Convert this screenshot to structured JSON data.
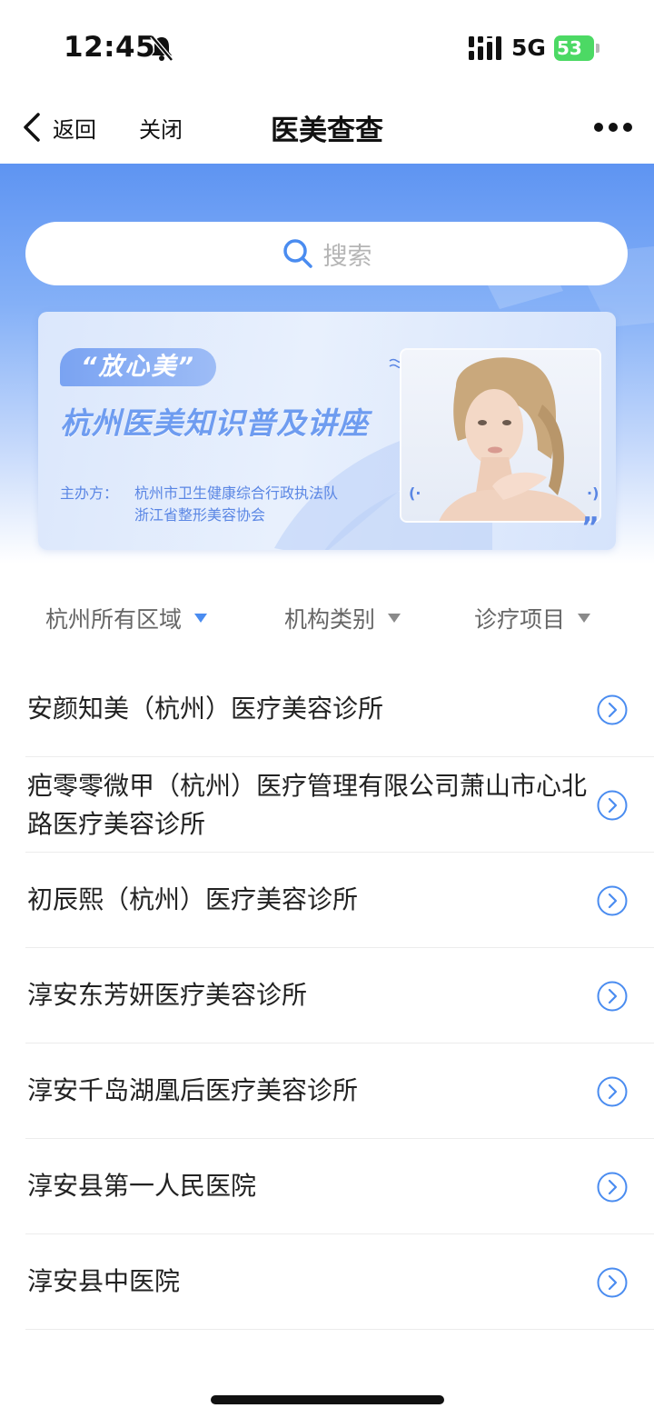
{
  "status_bar": {
    "time": "12:45",
    "network": "5G",
    "battery": "53",
    "icons": [
      "bell-slash-icon",
      "signal-icon",
      "battery-charging-icon"
    ]
  },
  "nav": {
    "back_label": "返回",
    "close_label": "关闭",
    "title": "医美查查",
    "icons": [
      "chevron-left-icon",
      "more-icon"
    ]
  },
  "search": {
    "placeholder": "搜索",
    "icon": "search-icon"
  },
  "banner": {
    "tag": "“放心美”",
    "headline": "杭州医美知识普及讲座",
    "organizer_label": "主办方：",
    "organizers": [
      "杭州市卫生健康综合行政执法队",
      "浙江省整形美容协会"
    ],
    "quote_mark": "”"
  },
  "filters": [
    {
      "label": "杭州所有区域",
      "active": true
    },
    {
      "label": "机构类别",
      "active": false
    },
    {
      "label": "诊疗项目",
      "active": false
    }
  ],
  "clinics": [
    {
      "name": "安颜知美（杭州）医疗美容诊所"
    },
    {
      "name": "疤零零微甲（杭州）医疗管理有限公司萧山市心北路医疗美容诊所"
    },
    {
      "name": "初辰熙（杭州）医疗美容诊所"
    },
    {
      "name": "淳安东芳妍医疗美容诊所"
    },
    {
      "name": "淳安千岛湖凰后医疗美容诊所"
    },
    {
      "name": "淳安县第一人民医院"
    },
    {
      "name": "淳安县中医院"
    }
  ],
  "colors": {
    "accent": "#4a8cf0",
    "hero_top": "#5e94f2",
    "battery": "#4cd964"
  }
}
